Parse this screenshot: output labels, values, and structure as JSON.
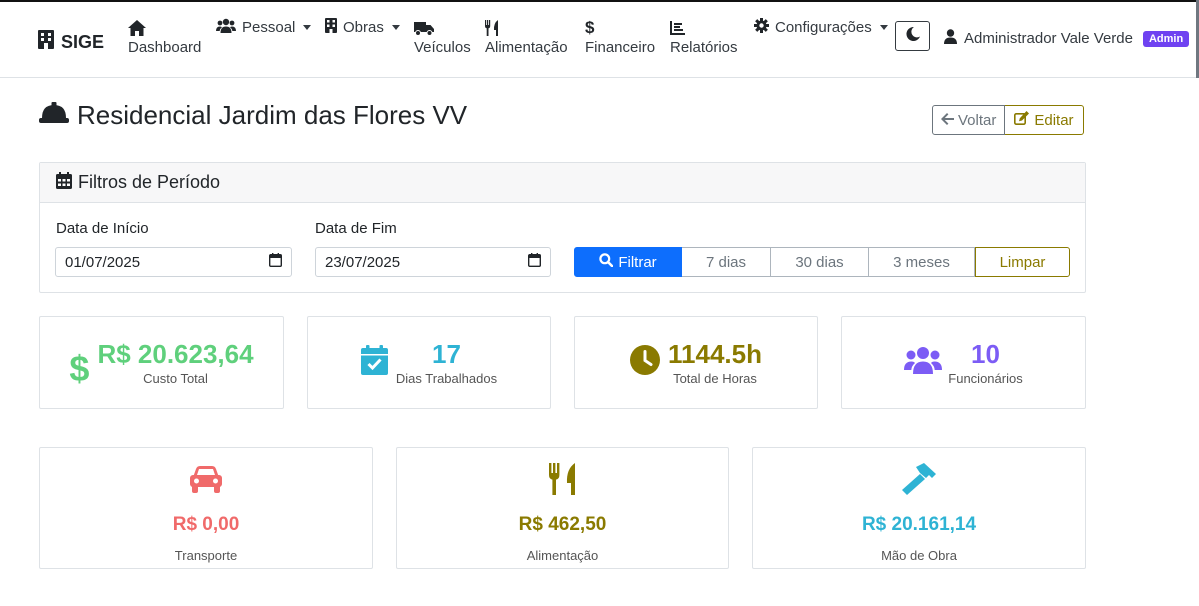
{
  "nav": {
    "brand": "SIGE",
    "dashboard": "Dashboard",
    "pessoal": "Pessoal",
    "obras": "Obras",
    "veiculos": "Veículos",
    "alimentacao": "Alimentação",
    "financeiro": "Financeiro",
    "relatorios": "Relatórios",
    "configuracoes": "Configurações",
    "user_name": "Administrador Vale Verde",
    "user_badge": "Admin"
  },
  "page": {
    "title": "Residencial Jardim das Flores VV",
    "back_label": "Voltar",
    "edit_label": "Editar"
  },
  "filters": {
    "header": "Filtros de Período",
    "start_label": "Data de Início",
    "start_value": "01/07/2025",
    "end_label": "Data de Fim",
    "end_value": "23/07/2025",
    "filter_btn": "Filtrar",
    "btn_7": "7 dias",
    "btn_30": "30 dias",
    "btn_3m": "3 meses",
    "clear_btn": "Limpar"
  },
  "stats": [
    {
      "value": "R$ 20.623,64",
      "label": "Custo Total",
      "color": "#5fd07c",
      "icon": "dollar-icon"
    },
    {
      "value": "17",
      "label": "Dias Trabalhados",
      "color": "#2eb3d4",
      "icon": "calendar-check-icon"
    },
    {
      "value": "1144.5h",
      "label": "Total de Horas",
      "color": "#8a7a00",
      "icon": "clock-icon"
    },
    {
      "value": "10",
      "label": "Funcionários",
      "color": "#7c5cf5",
      "icon": "users-icon"
    }
  ],
  "costs": [
    {
      "value": "R$ 0,00",
      "label": "Transporte",
      "color": "#f06a6a",
      "icon": "car-icon"
    },
    {
      "value": "R$ 462,50",
      "label": "Alimentação",
      "color": "#8a7a00",
      "icon": "utensils-icon"
    },
    {
      "value": "R$ 20.161,14",
      "label": "Mão de Obra",
      "color": "#2eb3d4",
      "icon": "hammer-icon"
    }
  ]
}
